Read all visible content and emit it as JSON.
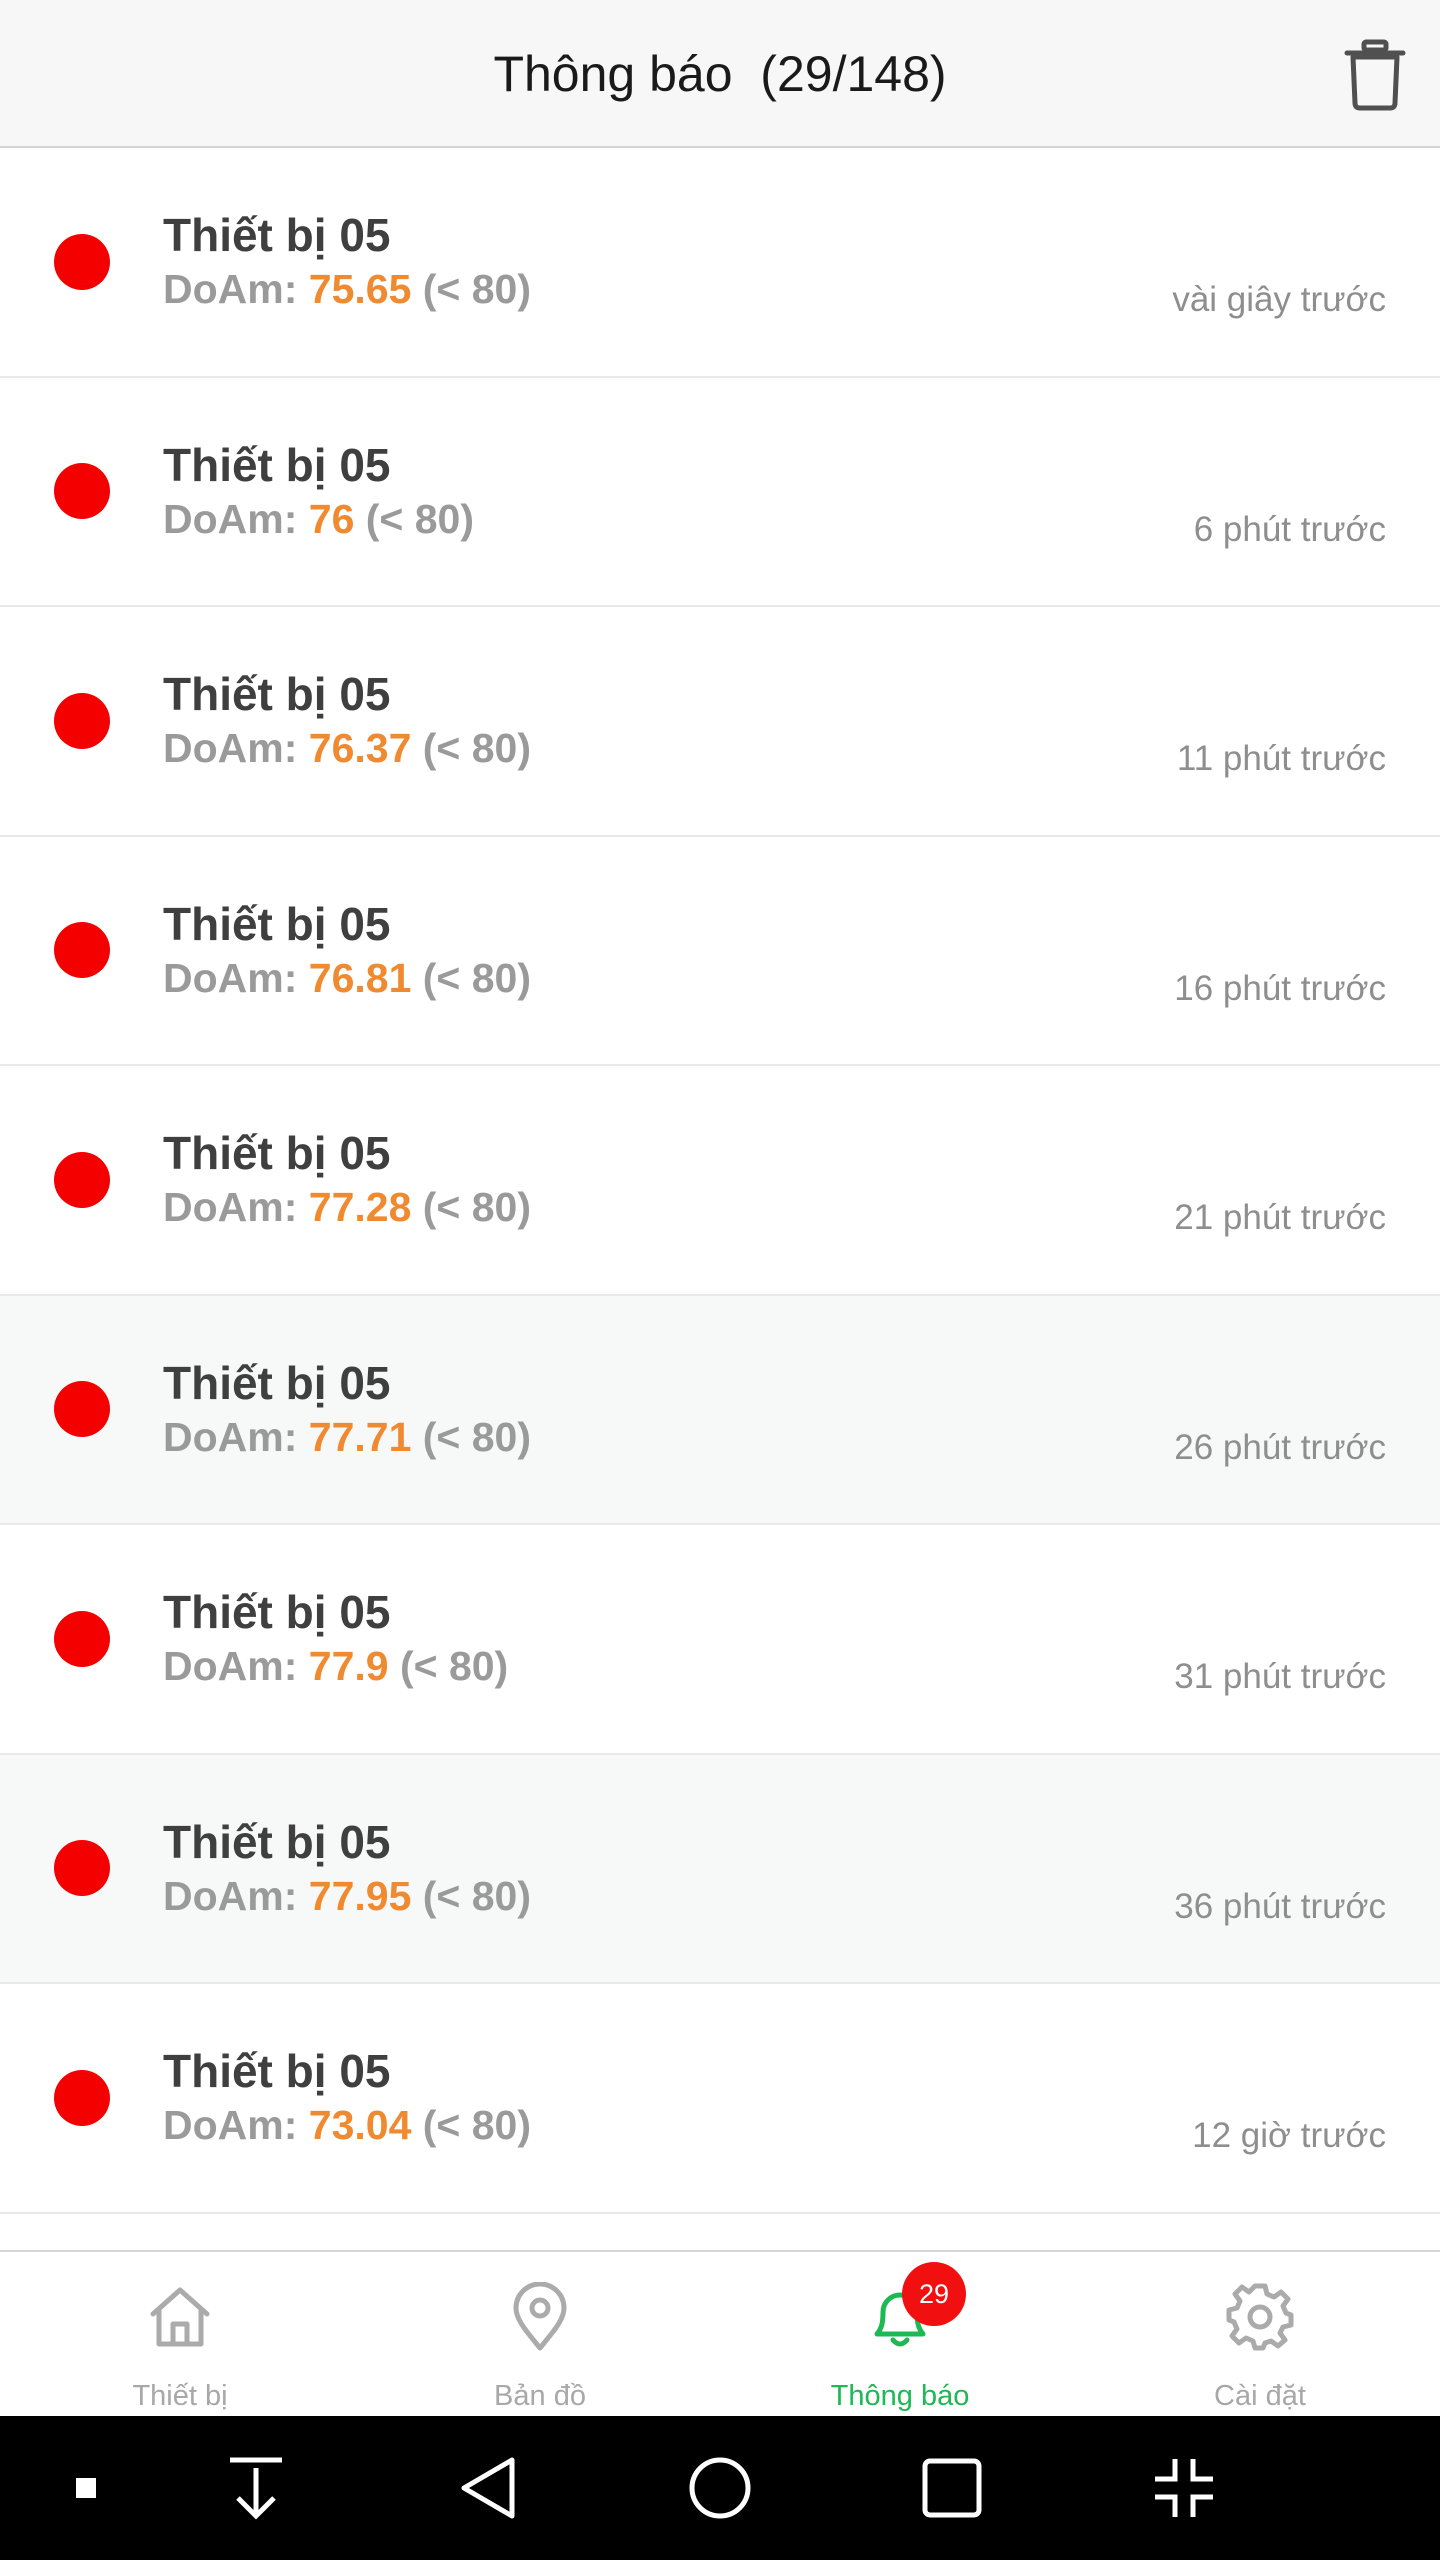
{
  "header": {
    "title": "Thông báo  (29/148)",
    "trash_icon": "trash-icon"
  },
  "notifications": [
    {
      "device": "Thiết bị 05",
      "label": "DoAm: ",
      "value": "75.65",
      "limit": " (< 80)",
      "time": "vài giây trước"
    },
    {
      "device": "Thiết bị 05",
      "label": "DoAm: ",
      "value": "76",
      "limit": " (< 80)",
      "time": "6 phút trước"
    },
    {
      "device": "Thiết bị 05",
      "label": "DoAm: ",
      "value": "76.37",
      "limit": " (< 80)",
      "time": "11 phút trước"
    },
    {
      "device": "Thiết bị 05",
      "label": "DoAm: ",
      "value": "76.81",
      "limit": " (< 80)",
      "time": "16 phút trước"
    },
    {
      "device": "Thiết bị 05",
      "label": "DoAm: ",
      "value": "77.28",
      "limit": " (< 80)",
      "time": "21 phút trước"
    },
    {
      "device": "Thiết bị 05",
      "label": "DoAm: ",
      "value": "77.71",
      "limit": " (< 80)",
      "time": "26 phút trước"
    },
    {
      "device": "Thiết bị 05",
      "label": "DoAm: ",
      "value": "77.9",
      "limit": " (< 80)",
      "time": "31 phút trước"
    },
    {
      "device": "Thiết bị 05",
      "label": "DoAm: ",
      "value": "77.95",
      "limit": " (< 80)",
      "time": "36 phút trước"
    },
    {
      "device": "Thiết bị 05",
      "label": "DoAm: ",
      "value": "73.04",
      "limit": " (< 80)",
      "time": "12 giờ trước"
    }
  ],
  "tabs": [
    {
      "label": "Thiết bị",
      "icon": "home-icon"
    },
    {
      "label": "Bản đồ",
      "icon": "map-pin-icon"
    },
    {
      "label": "Thông báo",
      "icon": "bell-icon",
      "active": true,
      "badge": "29"
    },
    {
      "label": "Cài đặt",
      "icon": "gear-icon"
    }
  ],
  "colors": {
    "accent": "#1db954",
    "alert_dot": "#f40000",
    "value": "#f08a30",
    "badge": "#f10f0f"
  },
  "system_nav": [
    "small-square-icon",
    "download-icon",
    "back-icon",
    "home-circle-icon",
    "recents-icon",
    "collapse-icon"
  ]
}
